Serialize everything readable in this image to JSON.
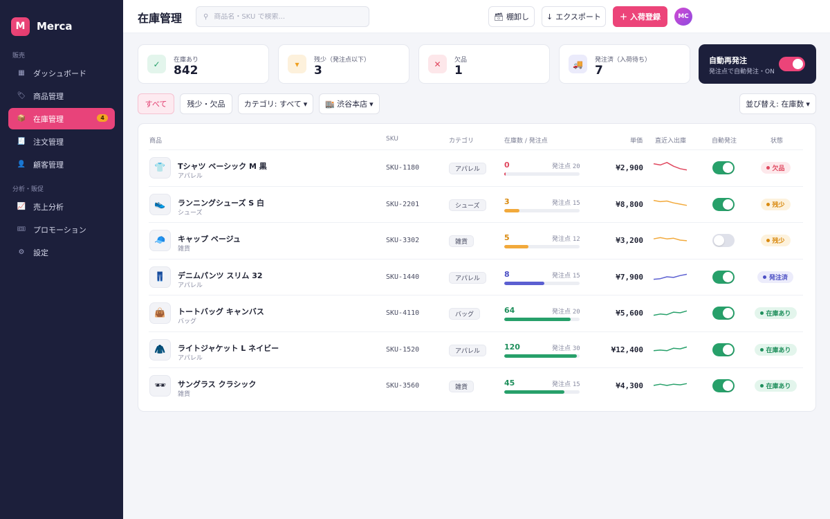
{
  "brand": {
    "initial": "M",
    "name": "Merca"
  },
  "sidebar": {
    "sections": [
      {
        "label": "販売",
        "items": [
          {
            "icon": "dashboard-icon",
            "glyph": "▦",
            "label": "ダッシュボード"
          },
          {
            "icon": "tag-icon",
            "glyph": "🏷",
            "label": "商品管理"
          },
          {
            "icon": "box-icon",
            "glyph": "📦",
            "label": "在庫管理",
            "badge": "4",
            "active": true
          },
          {
            "icon": "receipt-icon",
            "glyph": "🧾",
            "label": "注文管理"
          },
          {
            "icon": "user-icon",
            "glyph": "👤",
            "label": "顧客管理"
          }
        ]
      },
      {
        "label": "分析・販促",
        "items": [
          {
            "icon": "chart-icon",
            "glyph": "📈",
            "label": "売上分析"
          },
          {
            "icon": "ticket-icon",
            "glyph": "🎟",
            "label": "プロモーション"
          },
          {
            "icon": "gear-icon",
            "glyph": "⚙",
            "label": "設定"
          }
        ]
      }
    ]
  },
  "header": {
    "title": "在庫管理",
    "search_placeholder": "商品名・SKU で検索...",
    "stocktake_label": "棚卸し",
    "export_label": "エクスポート",
    "receive_label": "入荷登録",
    "avatar": "MC"
  },
  "stats": [
    {
      "label": "在庫あり",
      "value": "842",
      "icon": "check-icon",
      "glyph": "✓",
      "bg": "#e3f5ec",
      "fg": "#27a06a"
    },
    {
      "label": "残少（発注点以下）",
      "value": "3",
      "icon": "caret-down-icon",
      "glyph": "▾",
      "bg": "#fdf1dc",
      "fg": "#f0a020"
    },
    {
      "label": "欠品",
      "value": "1",
      "icon": "x-icon",
      "glyph": "✕",
      "bg": "#fde7ea",
      "fg": "#e0485f"
    },
    {
      "label": "発注済（入荷待ち）",
      "value": "7",
      "icon": "truck-icon",
      "glyph": "🚚",
      "bg": "#ebebfb",
      "fg": "#5b5fd1"
    }
  ],
  "auto_reorder": {
    "title": "自動再発注",
    "subtitle": "発注点で自動発注・ON",
    "enabled": true
  },
  "filters": {
    "all": "すべて",
    "low": "残少・欠品",
    "category": "カテゴリ: すべて",
    "store": "渋谷本店",
    "sort": "並び替え: 在庫数"
  },
  "table": {
    "headers": {
      "product": "商品",
      "sku": "SKU",
      "category": "カテゴリ",
      "stock": "在庫数 / 発注点",
      "price": "単価",
      "trend": "直近入出庫",
      "auto": "自動発注",
      "status": "状態"
    },
    "reorder_prefix": "発注点",
    "rows": [
      {
        "icon": "shirt-icon",
        "glyph": "👕",
        "name": "Tシャツ ベーシック M 黒",
        "sub": "アパレル",
        "sku": "SKU-1180",
        "category": "アパレル",
        "qty": "0",
        "reorder": "20",
        "level": 0.02,
        "price": "¥2,900",
        "trend": [
          8,
          7,
          9,
          6,
          4,
          3
        ],
        "auto": true,
        "status": "欠品",
        "tone": "red"
      },
      {
        "icon": "shoe-icon",
        "glyph": "👟",
        "name": "ランニングシューズ S 白",
        "sub": "シューズ",
        "sku": "SKU-2201",
        "category": "シューズ",
        "qty": "3",
        "reorder": "15",
        "level": 0.2,
        "price": "¥8,800",
        "trend": [
          8,
          7,
          7.5,
          6,
          5,
          4
        ],
        "auto": true,
        "status": "残少",
        "tone": "amber"
      },
      {
        "icon": "cap-icon",
        "glyph": "🧢",
        "name": "キャップ ベージュ",
        "sub": "雑貨",
        "sku": "SKU-3302",
        "category": "雑貨",
        "qty": "5",
        "reorder": "12",
        "level": 0.32,
        "price": "¥3,200",
        "trend": [
          6,
          7,
          6,
          6.5,
          5,
          4.5
        ],
        "auto": false,
        "status": "残少",
        "tone": "amber"
      },
      {
        "icon": "jeans-icon",
        "glyph": "👖",
        "name": "デニムパンツ スリム 32",
        "sub": "アパレル",
        "sku": "SKU-1440",
        "category": "アパレル",
        "qty": "8",
        "reorder": "15",
        "level": 0.53,
        "price": "¥7,900",
        "trend": [
          3,
          3.5,
          5,
          4.5,
          6,
          7
        ],
        "auto": true,
        "status": "発注済",
        "tone": "indigo"
      },
      {
        "icon": "bag-icon",
        "glyph": "👜",
        "name": "トートバッグ キャンバス",
        "sub": "バッグ",
        "sku": "SKU-4110",
        "category": "バッグ",
        "qty": "64",
        "reorder": "20",
        "level": 0.88,
        "price": "¥5,600",
        "trend": [
          3,
          4,
          3.5,
          5.5,
          5,
          6.5
        ],
        "auto": true,
        "status": "在庫あり",
        "tone": "green"
      },
      {
        "icon": "jacket-icon",
        "glyph": "🧥",
        "name": "ライトジャケット L ネイビー",
        "sub": "アパレル",
        "sku": "SKU-1520",
        "category": "アパレル",
        "qty": "120",
        "reorder": "30",
        "level": 0.96,
        "price": "¥12,400",
        "trend": [
          4,
          4.5,
          4,
          6,
          5.5,
          7
        ],
        "auto": true,
        "status": "在庫あり",
        "tone": "green"
      },
      {
        "icon": "sunglasses-icon",
        "glyph": "🕶",
        "name": "サングラス クラシック",
        "sub": "雑貨",
        "sku": "SKU-3560",
        "category": "雑貨",
        "qty": "45",
        "reorder": "15",
        "level": 0.8,
        "price": "¥4,300",
        "trend": [
          5,
          6,
          5,
          6,
          5.5,
          6.5
        ],
        "auto": true,
        "status": "在庫あり",
        "tone": "green"
      }
    ]
  },
  "tones": {
    "red": {
      "fg": "#e0485f",
      "bg": "#fde8eb",
      "bar": "#e0485f"
    },
    "amber": {
      "fg": "#d98a10",
      "bg": "#fdf2dd",
      "bar": "#f2a93b"
    },
    "indigo": {
      "fg": "#4b4fc4",
      "bg": "#ececfb",
      "bar": "#5b5fd1"
    },
    "green": {
      "fg": "#1f8f5c",
      "bg": "#e3f5ec",
      "bar": "#27a06a"
    }
  }
}
